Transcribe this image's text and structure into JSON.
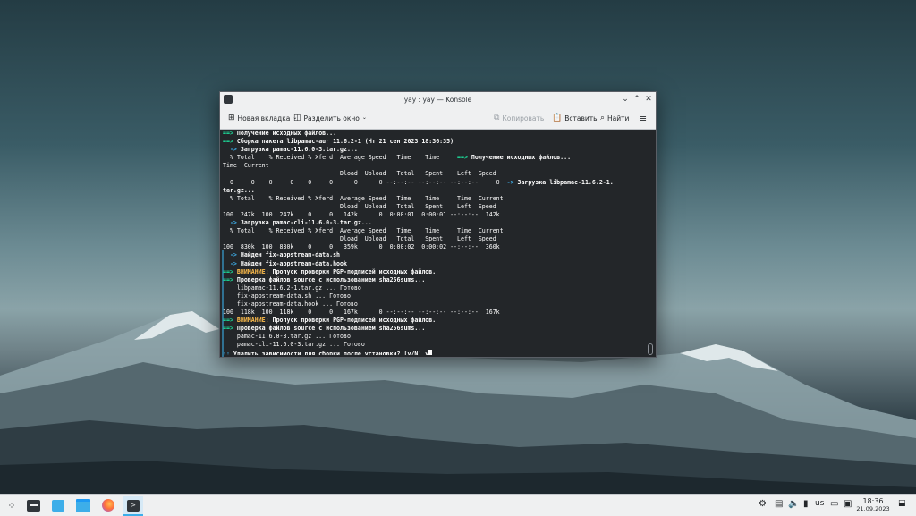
{
  "window": {
    "title": "yay : yay — Konsole",
    "buttons": {
      "minimize": "⌄",
      "maximize": "⌃",
      "close": "✕"
    }
  },
  "toolbar": {
    "new_tab": "Новая вкладка",
    "split": "Разделить окно",
    "copy": "Копировать",
    "paste": "Вставить",
    "find": "Найти",
    "menu_icon": "hamburger-icon"
  },
  "terminal": {
    "lines": [
      [
        {
          "c": "g",
          "t": "==> "
        },
        {
          "c": "w",
          "t": "Получение исходных файлов..."
        }
      ],
      [
        {
          "c": "g",
          "t": "==> "
        },
        {
          "c": "w",
          "t": "Сборка пакета libpamac-aur 11.6.2-1 (Чт 21 сен 2023 18:36:35)"
        }
      ],
      [
        {
          "c": "b",
          "t": "  -> "
        },
        {
          "c": "w",
          "t": "Загрузка pamac-11.6.0-3.tar.gz..."
        }
      ],
      [
        {
          "c": "",
          "t": "  % Total    % Received % Xferd  Average Speed   Time    Time     "
        },
        {
          "c": "g",
          "t": "==> "
        },
        {
          "c": "w",
          "t": "Получение исходных файлов..."
        }
      ],
      [
        {
          "c": "",
          "t": "Time  Current"
        }
      ],
      [
        {
          "c": "",
          "t": "                                 Dload  Upload   Total   Spent    Left  Speed"
        }
      ],
      [
        {
          "c": "",
          "t": "  0     0    0     0    0     0      0      0 --:--:-- --:--:-- --:--:--     0  "
        },
        {
          "c": "b",
          "t": "-> "
        },
        {
          "c": "w",
          "t": "Загрузка libpamac-11.6.2-1."
        }
      ],
      [
        {
          "c": "w",
          "t": "tar.gz..."
        }
      ],
      [
        {
          "c": "",
          "t": "  % Total    % Received % Xferd  Average Speed   Time    Time     Time  Current"
        }
      ],
      [
        {
          "c": "",
          "t": "                                 Dload  Upload   Total   Spent    Left  Speed"
        }
      ],
      [
        {
          "c": "",
          "t": "100  247k  100  247k    0     0   142k      0  0:00:01  0:00:01 --:--:--  142k"
        }
      ],
      [
        {
          "c": "b",
          "t": "  -> "
        },
        {
          "c": "w",
          "t": "Загрузка pamac-cli-11.6.0-3.tar.gz..."
        }
      ],
      [
        {
          "c": "",
          "t": "  % Total    % Received % Xferd  Average Speed   Time    Time     Time  Current"
        }
      ],
      [
        {
          "c": "",
          "t": "                                 Dload  Upload   Total   Spent    Left  Speed"
        }
      ],
      [
        {
          "c": "",
          "t": "100  830k  100  830k    0     0   359k      0  0:00:02  0:00:02 --:--:--  360k"
        }
      ],
      [
        {
          "c": "b",
          "t": "  -> "
        },
        {
          "c": "w",
          "t": "Найден fix-appstream-data.sh"
        }
      ],
      [
        {
          "c": "b",
          "t": "  -> "
        },
        {
          "c": "w",
          "t": "Найден fix-appstream-data.hook"
        }
      ],
      [
        {
          "c": "g",
          "t": "==> "
        },
        {
          "c": "y",
          "t": "ВНИМАНИЕ: "
        },
        {
          "c": "w",
          "t": "Пропуск проверки PGP-подписей исходных файлов."
        }
      ],
      [
        {
          "c": "g",
          "t": "==> "
        },
        {
          "c": "w",
          "t": "Проверка файлов source с использованием sha256sums..."
        }
      ],
      [
        {
          "c": "",
          "t": "    libpamac-11.6.2-1.tar.gz ... Готово"
        }
      ],
      [
        {
          "c": "",
          "t": "    fix-appstream-data.sh ... Готово"
        }
      ],
      [
        {
          "c": "",
          "t": "    fix-appstream-data.hook ... Готово"
        }
      ],
      [
        {
          "c": "",
          "t": "100  118k  100  118k    0     0   167k      0 --:--:-- --:--:-- --:--:--  167k"
        }
      ],
      [
        {
          "c": "g",
          "t": "==> "
        },
        {
          "c": "y",
          "t": "ВНИМАНИЕ: "
        },
        {
          "c": "w",
          "t": "Пропуск проверки PGP-подписей исходных файлов."
        }
      ],
      [
        {
          "c": "g",
          "t": "==> "
        },
        {
          "c": "w",
          "t": "Проверка файлов source с использованием sha256sums..."
        }
      ],
      [
        {
          "c": "",
          "t": "    pamac-11.6.0-3.tar.gz ... Готово"
        }
      ],
      [
        {
          "c": "",
          "t": "    pamac-cli-11.6.0-3.tar.gz ... Готово"
        }
      ],
      [
        {
          "c": "b",
          "t": ":: "
        },
        {
          "c": "w",
          "t": "Удалить зависимости для сборки после установки? [y/N] y"
        }
      ]
    ]
  },
  "taskbar": {
    "launcher_icon": "app-launcher-icon",
    "apps": [
      "pager-icon",
      "discover-icon",
      "dolphin-icon",
      "firefox-icon",
      "konsole-icon"
    ],
    "tray_icons": [
      "network-settings-icon",
      "clipboard-icon",
      "volume-icon",
      "usb-icon"
    ],
    "keyboard_layout": "us",
    "tray_icons_right": [
      "display-icon",
      "network-icon",
      "expand-tray-icon"
    ],
    "time": "18:36",
    "date": "21.09.2023"
  },
  "colors": {
    "terminal_bg": "#232629",
    "arrow_green": "#1cdc9a",
    "arrow_blue": "#3daee9",
    "warning_yellow": "#fdbc4b"
  }
}
